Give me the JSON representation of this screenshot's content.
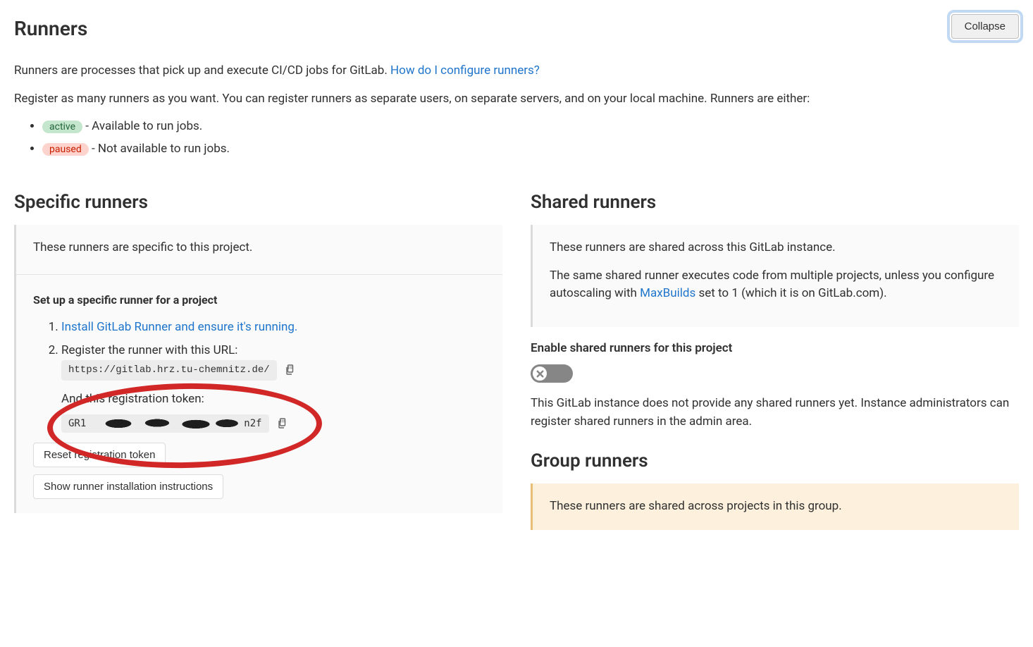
{
  "header": {
    "title": "Runners",
    "collapse_label": "Collapse"
  },
  "intro": {
    "desc": "Runners are processes that pick up and execute CI/CD jobs for GitLab. ",
    "link_text": "How do I configure runners?",
    "paragraph": "Register as many runners as you want. You can register runners as separate users, on separate servers, and on your local machine. Runners are either:",
    "active_badge": "active",
    "active_text": " - Available to run jobs.",
    "paused_badge": "paused",
    "paused_text": " - Not available to run jobs."
  },
  "specific": {
    "heading": "Specific runners",
    "panel_text": "These runners are specific to this project.",
    "setup_heading": "Set up a specific runner for a project",
    "step1_link": "Install GitLab Runner and ensure it's running.",
    "step2_text": "Register the runner with this URL:",
    "url": "https://gitlab.hrz.tu-chemnitz.de/",
    "token_label": "And this registration token:",
    "token_prefix": "GR1",
    "token_suffix": "n2f",
    "reset_button": "Reset registration token",
    "instructions_button": "Show runner installation instructions"
  },
  "shared": {
    "heading": "Shared runners",
    "panel_text1": "These runners are shared across this GitLab instance.",
    "panel_text2a": "The same shared runner executes code from multiple projects, unless you configure autoscaling with ",
    "panel_link": "MaxBuilds",
    "panel_text2b": " set to 1 (which it is on GitLab.com).",
    "toggle_label": "Enable shared runners for this project",
    "note": "This GitLab instance does not provide any shared runners yet. Instance administrators can register shared runners in the admin area."
  },
  "group": {
    "heading": "Group runners",
    "panel_text": "These runners are shared across projects in this group."
  }
}
